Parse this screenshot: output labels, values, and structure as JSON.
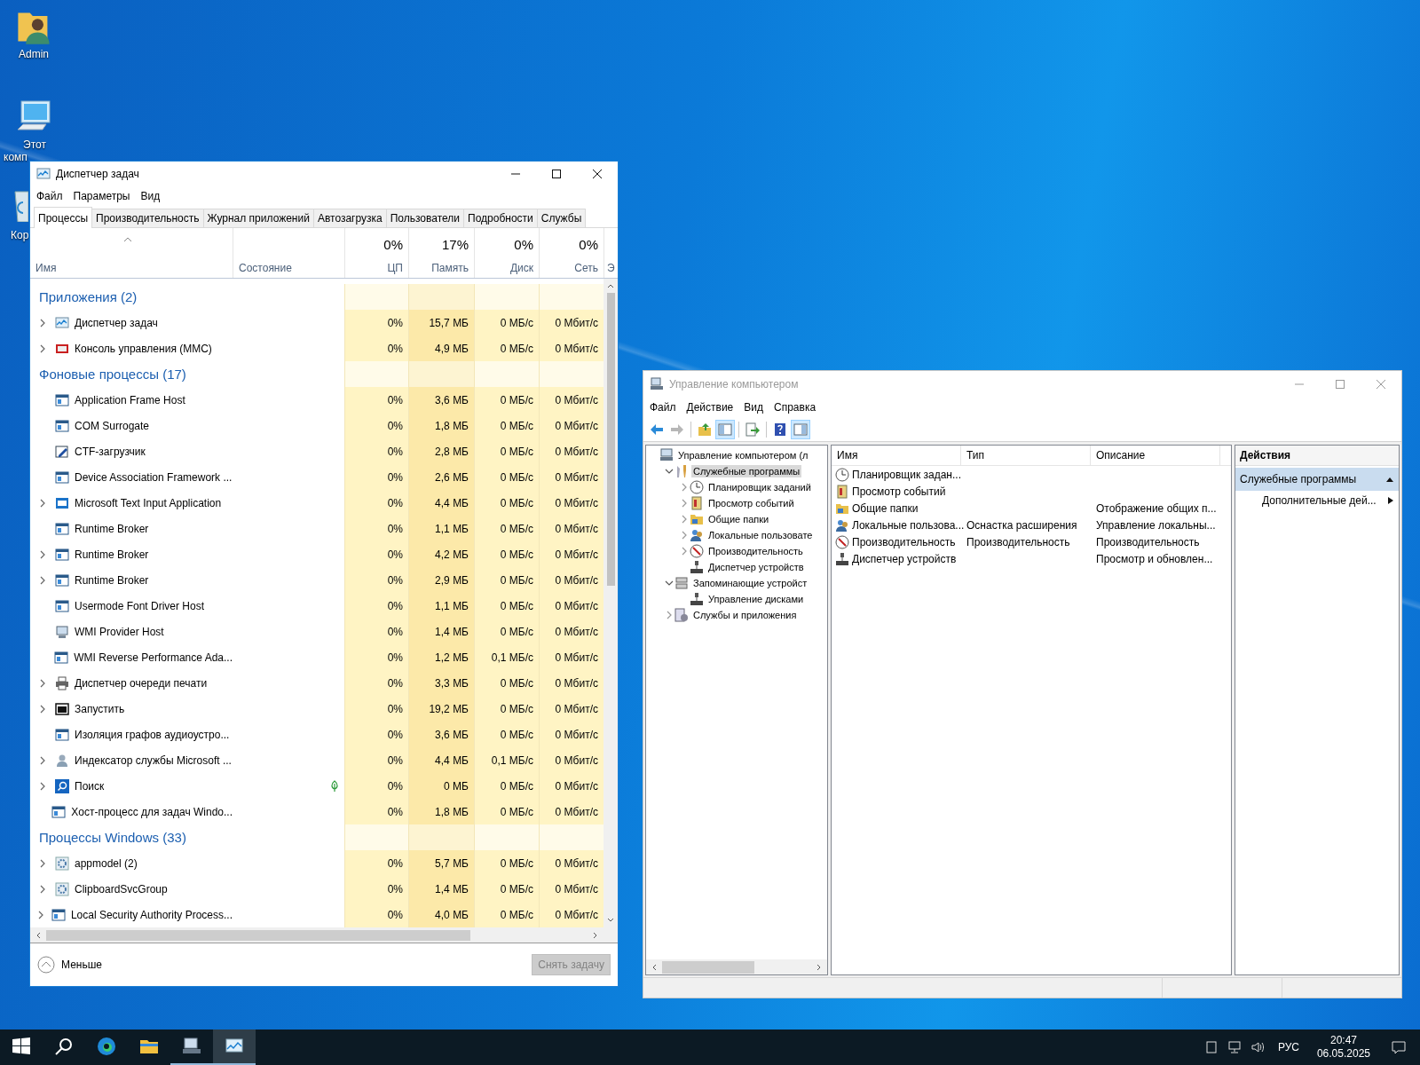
{
  "desktop_icons": [
    {
      "kind": "user-folder",
      "lines": [
        "Admin"
      ],
      "partly_hidden": false
    },
    {
      "kind": "computer",
      "lines": [
        "Этот",
        "комп"
      ],
      "partly_hidden": true
    },
    {
      "kind": "recycle-bin",
      "lines": [
        "Кор"
      ],
      "partly_hidden": true
    }
  ],
  "task_manager": {
    "title": "Диспетчер задач",
    "menu": [
      "Файл",
      "Параметры",
      "Вид"
    ],
    "tabs": [
      {
        "label": "Процессы",
        "selected": true
      },
      {
        "label": "Производительность",
        "selected": false
      },
      {
        "label": "Журнал приложений",
        "selected": false
      },
      {
        "label": "Автозагрузка",
        "selected": false
      },
      {
        "label": "Пользователи",
        "selected": false
      },
      {
        "label": "Подробности",
        "selected": false
      },
      {
        "label": "Службы",
        "selected": false
      }
    ],
    "columns": [
      {
        "kind": "name",
        "label": "Имя"
      },
      {
        "kind": "status",
        "label": "Состояние"
      },
      {
        "kind": "metric",
        "total": "0%",
        "label": "ЦП"
      },
      {
        "kind": "metric",
        "total": "17%",
        "label": "Память"
      },
      {
        "kind": "metric",
        "total": "0%",
        "label": "Диск"
      },
      {
        "kind": "metric",
        "total": "0%",
        "label": "Сеть"
      },
      {
        "kind": "cut",
        "label": "Э"
      }
    ],
    "groups": [
      {
        "title": "Приложения (2)",
        "rows": [
          {
            "name": "Диспетчер задач",
            "kind": "chart",
            "expandable": true,
            "efficiency_mode": false,
            "values": [
              "0%",
              "15,7 МБ",
              "0 МБ/с",
              "0 Мбит/с"
            ]
          },
          {
            "name": "Консоль управления (MMC)",
            "kind": "console",
            "expandable": true,
            "efficiency_mode": false,
            "values": [
              "0%",
              "4,9 МБ",
              "0 МБ/с",
              "0 Мбит/с"
            ]
          }
        ]
      },
      {
        "title": "Фоновые процессы (17)",
        "rows": [
          {
            "name": "Application Frame Host",
            "kind": "window",
            "expandable": false,
            "efficiency_mode": false,
            "values": [
              "0%",
              "3,6 МБ",
              "0 МБ/с",
              "0 Мбит/с"
            ]
          },
          {
            "name": "COM Surrogate",
            "kind": "window",
            "expandable": false,
            "efficiency_mode": false,
            "values": [
              "0%",
              "1,8 МБ",
              "0 МБ/с",
              "0 Мбит/с"
            ]
          },
          {
            "name": "CTF-загрузчик",
            "kind": "pen",
            "expandable": false,
            "efficiency_mode": false,
            "values": [
              "0%",
              "2,8 МБ",
              "0 МБ/с",
              "0 Мбит/с"
            ]
          },
          {
            "name": "Device Association Framework ...",
            "kind": "window",
            "expandable": false,
            "efficiency_mode": false,
            "values": [
              "0%",
              "2,6 МБ",
              "0 МБ/с",
              "0 Мбит/с"
            ]
          },
          {
            "name": "Microsoft Text Input Application",
            "kind": "tile",
            "expandable": true,
            "efficiency_mode": false,
            "values": [
              "0%",
              "4,4 МБ",
              "0 МБ/с",
              "0 Мбит/с"
            ]
          },
          {
            "name": "Runtime Broker",
            "kind": "window",
            "expandable": false,
            "efficiency_mode": false,
            "values": [
              "0%",
              "1,1 МБ",
              "0 МБ/с",
              "0 Мбит/с"
            ]
          },
          {
            "name": "Runtime Broker",
            "kind": "window",
            "expandable": true,
            "efficiency_mode": false,
            "values": [
              "0%",
              "4,2 МБ",
              "0 МБ/с",
              "0 Мбит/с"
            ]
          },
          {
            "name": "Runtime Broker",
            "kind": "window",
            "expandable": true,
            "efficiency_mode": false,
            "values": [
              "0%",
              "2,9 МБ",
              "0 МБ/с",
              "0 Мбит/с"
            ]
          },
          {
            "name": "Usermode Font Driver Host",
            "kind": "window",
            "expandable": false,
            "efficiency_mode": false,
            "values": [
              "0%",
              "1,1 МБ",
              "0 МБ/с",
              "0 Мбит/с"
            ]
          },
          {
            "name": "WMI Provider Host",
            "kind": "computer",
            "expandable": false,
            "efficiency_mode": false,
            "values": [
              "0%",
              "1,4 МБ",
              "0 МБ/с",
              "0 Мбит/с"
            ]
          },
          {
            "name": "WMI Reverse Performance Ada...",
            "kind": "window",
            "expandable": false,
            "efficiency_mode": false,
            "values": [
              "0%",
              "1,2 МБ",
              "0,1 МБ/с",
              "0 Мбит/с"
            ]
          },
          {
            "name": "Диспетчер очереди печати",
            "kind": "printer",
            "expandable": true,
            "efficiency_mode": false,
            "values": [
              "0%",
              "3,3 МБ",
              "0 МБ/с",
              "0 Мбит/с"
            ]
          },
          {
            "name": "Запустить",
            "kind": "terminal",
            "expandable": true,
            "efficiency_mode": false,
            "values": [
              "0%",
              "19,2 МБ",
              "0 МБ/с",
              "0 Мбит/с"
            ]
          },
          {
            "name": "Изоляция графов аудиоустро...",
            "kind": "window",
            "expandable": false,
            "efficiency_mode": false,
            "values": [
              "0%",
              "3,6 МБ",
              "0 МБ/с",
              "0 Мбит/с"
            ]
          },
          {
            "name": "Индексатор службы Microsoft ...",
            "kind": "person",
            "expandable": true,
            "efficiency_mode": false,
            "values": [
              "0%",
              "4,4 МБ",
              "0,1 МБ/с",
              "0 Мбит/с"
            ]
          },
          {
            "name": "Поиск",
            "kind": "search",
            "expandable": true,
            "efficiency_mode": true,
            "values": [
              "0%",
              "0 МБ",
              "0 МБ/с",
              "0 Мбит/с"
            ]
          },
          {
            "name": "Хост-процесс для задач Windo...",
            "kind": "window",
            "expandable": false,
            "efficiency_mode": false,
            "values": [
              "0%",
              "1,8 МБ",
              "0 МБ/с",
              "0 Мбит/с"
            ]
          }
        ]
      },
      {
        "title": "Процессы Windows (33)",
        "rows": [
          {
            "name": "appmodel (2)",
            "kind": "gear",
            "expandable": true,
            "efficiency_mode": false,
            "values": [
              "0%",
              "5,7 МБ",
              "0 МБ/с",
              "0 Мбит/с"
            ]
          },
          {
            "name": "ClipboardSvcGroup",
            "kind": "gear",
            "expandable": true,
            "efficiency_mode": false,
            "values": [
              "0%",
              "1,4 МБ",
              "0 МБ/с",
              "0 Мбит/с"
            ]
          },
          {
            "name": "Local Security Authority Process...",
            "kind": "window",
            "expandable": true,
            "efficiency_mode": false,
            "values": [
              "0%",
              "4,0 МБ",
              "0 МБ/с",
              "0 Мбит/с"
            ]
          }
        ]
      }
    ],
    "fewer_details": "Меньше",
    "end_task": {
      "label": "Снять задачу",
      "disabled": true
    }
  },
  "mmc": {
    "title": "Управление компьютером",
    "menu": [
      "Файл",
      "Действие",
      "Вид",
      "Справка"
    ],
    "toolbar": [
      {
        "kind": "back",
        "pressed": false,
        "disabled": false
      },
      {
        "kind": "forward",
        "pressed": false,
        "disabled": true
      },
      {
        "kind": "separator"
      },
      {
        "kind": "up-folder",
        "pressed": false,
        "disabled": false
      },
      {
        "kind": "tree-toggle",
        "pressed": true,
        "disabled": false
      },
      {
        "kind": "separator"
      },
      {
        "kind": "export",
        "pressed": false,
        "disabled": false
      },
      {
        "kind": "separator"
      },
      {
        "kind": "help",
        "pressed": false,
        "disabled": false
      },
      {
        "kind": "pane-toggle",
        "pressed": true,
        "disabled": false
      }
    ],
    "tree": [
      {
        "label": "Управление компьютером (л",
        "kind": "computer",
        "expandable": false,
        "selected": false,
        "children": [
          {
            "label": "Служебные программы",
            "kind": "tools",
            "expandable": true,
            "expanded": true,
            "selected": true,
            "children": [
              {
                "label": "Планировщик заданий",
                "kind": "clock",
                "expandable": true,
                "expanded": false,
                "selected": false
              },
              {
                "label": "Просмотр событий",
                "kind": "book",
                "expandable": true,
                "expanded": false,
                "selected": false
              },
              {
                "label": "Общие папки",
                "kind": "folder",
                "expandable": true,
                "expanded": false,
                "selected": false
              },
              {
                "label": "Локальные пользовате",
                "kind": "people",
                "expandable": true,
                "expanded": false,
                "selected": false
              },
              {
                "label": "Производительность",
                "kind": "perf",
                "expandable": true,
                "expanded": false,
                "selected": false
              },
              {
                "label": "Диспетчер устройств",
                "kind": "device",
                "expandable": false,
                "selected": false
              }
            ]
          },
          {
            "label": "Запоминающие устройст",
            "kind": "storage",
            "expandable": true,
            "expanded": true,
            "selected": false,
            "children": [
              {
                "label": "Управление дисками",
                "kind": "device",
                "expandable": false,
                "selected": false
              }
            ]
          },
          {
            "label": "Службы и приложения",
            "kind": "services",
            "expandable": true,
            "expanded": false,
            "selected": false
          }
        ]
      }
    ],
    "list_columns": [
      "Имя",
      "Тип",
      "Описание"
    ],
    "list_rows": [
      {
        "kind": "clock",
        "cells": [
          "Планировщик задан...",
          "",
          ""
        ]
      },
      {
        "kind": "book",
        "cells": [
          "Просмотр событий",
          "",
          ""
        ]
      },
      {
        "kind": "folder",
        "cells": [
          "Общие папки",
          "",
          "Отображение общих п..."
        ]
      },
      {
        "kind": "people",
        "cells": [
          "Локальные пользова...",
          "Оснастка расширения",
          "Управление локальны..."
        ]
      },
      {
        "kind": "perf",
        "cells": [
          "Производительность",
          "Производительность",
          "Производительность"
        ]
      },
      {
        "kind": "device",
        "cells": [
          "Диспетчер устройств",
          "",
          "Просмотр и обновлен..."
        ]
      }
    ],
    "actions": {
      "title": "Действия",
      "section": "Служебные программы",
      "items": [
        "Дополнительные дей..."
      ]
    }
  },
  "taskbar": {
    "buttons": [
      {
        "kind": "start",
        "running": false,
        "selected": false
      },
      {
        "kind": "search",
        "running": false,
        "selected": false
      },
      {
        "kind": "browser",
        "running": false,
        "selected": false
      },
      {
        "kind": "folder",
        "running": false,
        "selected": false
      },
      {
        "kind": "console",
        "running": true,
        "selected": false
      },
      {
        "kind": "chart",
        "running": true,
        "selected": true
      }
    ],
    "language": "РУС",
    "time": "20:47",
    "date": "06.05.2025"
  }
}
